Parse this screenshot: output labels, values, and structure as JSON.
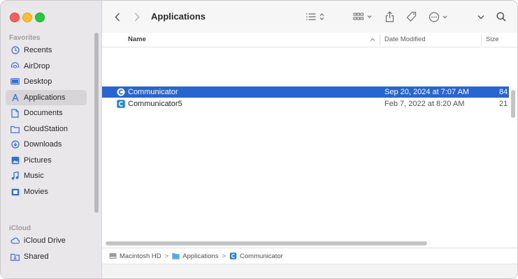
{
  "toolbar": {
    "title": "Applications",
    "back_icon": "chevron-left-icon",
    "forward_icon": "chevron-right-icon"
  },
  "sidebar": {
    "favorites_label": "Favorites",
    "icloud_label": "iCloud",
    "favorites": [
      {
        "label": "Recents",
        "icon": "clock-icon"
      },
      {
        "label": "AirDrop",
        "icon": "airdrop-icon"
      },
      {
        "label": "Desktop",
        "icon": "desktop-icon"
      },
      {
        "label": "Applications",
        "icon": "applications-icon",
        "active": true
      },
      {
        "label": "Documents",
        "icon": "document-icon"
      },
      {
        "label": "CloudStation",
        "icon": "folder-icon"
      },
      {
        "label": "Downloads",
        "icon": "download-icon"
      },
      {
        "label": "Pictures",
        "icon": "pictures-icon"
      },
      {
        "label": "Music",
        "icon": "music-icon"
      },
      {
        "label": "Movies",
        "icon": "movies-icon"
      }
    ],
    "icloud": [
      {
        "label": "iCloud Drive",
        "icon": "cloud-icon"
      },
      {
        "label": "Shared",
        "icon": "shared-folder-icon"
      }
    ]
  },
  "columns": {
    "name": "Name",
    "date": "Date Modified",
    "size": "Size"
  },
  "files": [
    {
      "name": "Communicator",
      "date": "Sep 20, 2024 at 7:07 AM",
      "size": "84",
      "selected": true
    },
    {
      "name": "Communicator5",
      "date": "Feb 7, 2022 at 8:20 AM",
      "size": "21",
      "selected": false
    }
  ],
  "pathbar": {
    "segments": [
      "Macintosh HD",
      "Applications",
      "Communicator"
    ],
    "separator": ">"
  },
  "colors": {
    "accent": "#2865d1",
    "sidebar_icon": "#2f6ee0"
  }
}
